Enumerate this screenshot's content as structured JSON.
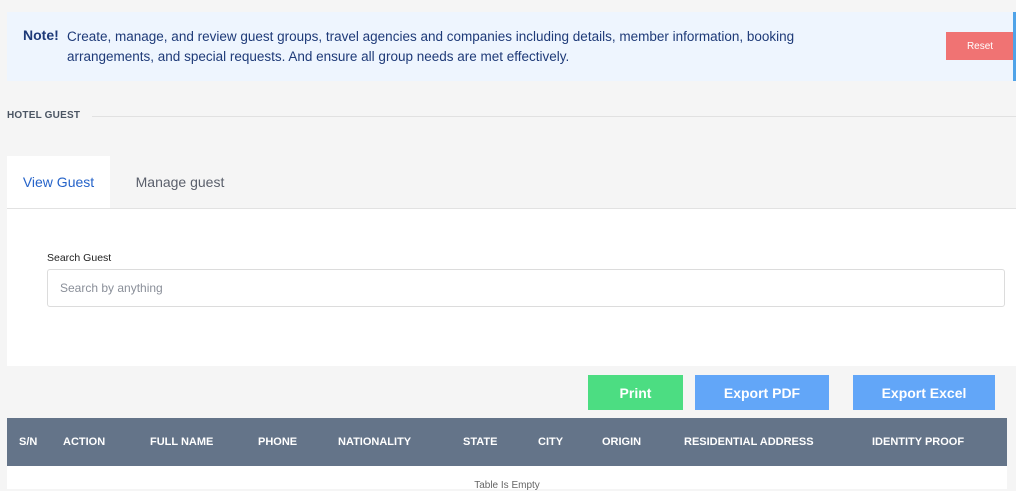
{
  "note": {
    "label": "Note!",
    "text": "Create, manage, and review guest groups, travel agencies and companies including details, member information, booking arrangements, and special requests. And ensure all group needs are met effectively.",
    "reset_label": "Reset"
  },
  "section": {
    "title": "HOTEL GUEST"
  },
  "tabs": [
    {
      "label": "View Guest",
      "active": true
    },
    {
      "label": "Manage guest",
      "active": false
    }
  ],
  "search": {
    "label": "Search Guest",
    "placeholder": "Search by anything",
    "value": ""
  },
  "actions": {
    "print": "Print",
    "export_pdf": "Export PDF",
    "export_excel": "Export Excel"
  },
  "table": {
    "columns": [
      "S/N",
      "ACTION",
      "FULL NAME",
      "PHONE",
      "NATIONALITY",
      "STATE",
      "CITY",
      "ORIGIN",
      "RESIDENTIAL ADDRESS",
      "IDENTITY PROOF"
    ],
    "empty_text": "Table Is Empty"
  },
  "colors": {
    "note_bg": "#eef5fe",
    "reset": "#f07373",
    "tab_active": "#2563c9",
    "print": "#4cdd82",
    "export": "#62a6f8",
    "table_header": "#647489"
  }
}
